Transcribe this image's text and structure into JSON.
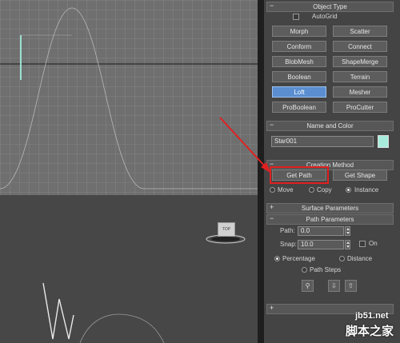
{
  "rollouts": {
    "object_type": {
      "title": "Object Type",
      "autogrid": "AutoGrid",
      "buttons": [
        "Morph",
        "Scatter",
        "Conform",
        "Connect",
        "BlobMesh",
        "ShapeMerge",
        "Boolean",
        "Terrain",
        "Loft",
        "Mesher",
        "ProBoolean",
        "ProCutter"
      ],
      "active": "Loft"
    },
    "name_color": {
      "title": "Name and Color",
      "name_value": "Star001",
      "swatch_color": "#a8ecdc"
    },
    "creation_method": {
      "title": "Creation Method",
      "get_path": "Get Path",
      "get_shape": "Get Shape",
      "options": [
        "Move",
        "Copy",
        "Instance"
      ],
      "selected": "Instance"
    },
    "surface_parameters": {
      "title": "Surface Parameters"
    },
    "path_parameters": {
      "title": "Path Parameters",
      "path_label": "Path:",
      "path_value": "0.0",
      "snap_label": "Snap:",
      "snap_value": "10.0",
      "on_label": "On",
      "mode_options": [
        "Percentage",
        "Distance",
        "Path Steps"
      ],
      "selected_mode": "Percentage"
    }
  },
  "viewport": {
    "cube_label": "TOP"
  },
  "watermark": {
    "line1": "jb51.net",
    "line2": "脚本之家"
  },
  "colors": {
    "accent_blue": "#5a8ed0",
    "highlight_red": "#e02020"
  }
}
